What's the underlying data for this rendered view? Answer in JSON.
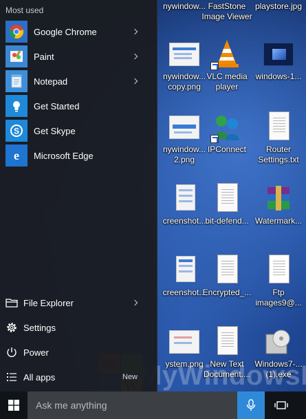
{
  "start_menu": {
    "section_title": "Most used",
    "apps": [
      {
        "label": "Google Chrome",
        "icon": "chrome-icon",
        "has_submenu": true,
        "tile_color": "#2c6fc4"
      },
      {
        "label": "Paint",
        "icon": "paint-icon",
        "has_submenu": true,
        "tile_color": "#3a88d4"
      },
      {
        "label": "Notepad",
        "icon": "notepad-icon",
        "has_submenu": true,
        "tile_color": "#3c8fd8"
      },
      {
        "label": "Get Started",
        "icon": "lightbulb-icon",
        "has_submenu": false,
        "tile_color": "#1e88d9"
      },
      {
        "label": "Get Skype",
        "icon": "skype-icon",
        "has_submenu": false,
        "tile_color": "#1e88d9"
      },
      {
        "label": "Microsoft Edge",
        "icon": "edge-icon",
        "has_submenu": false,
        "tile_color": "#1e74d0"
      }
    ],
    "system": {
      "file_explorer": "File Explorer",
      "settings": "Settings",
      "power": "Power",
      "all_apps": "All apps",
      "new_badge": "New"
    }
  },
  "desktop": {
    "icons": [
      {
        "label": "nywindow...",
        "type": "image"
      },
      {
        "label": "FastStone Image Viewer",
        "type": "app"
      },
      {
        "label": "playstore.jpg",
        "type": "image"
      },
      {
        "label": "nywindow... copy.png",
        "type": "image"
      },
      {
        "label": "VLC media player",
        "type": "vlc"
      },
      {
        "label": "windows-1...",
        "type": "image"
      },
      {
        "label": "nywindow... 2.png",
        "type": "image"
      },
      {
        "label": "IPConnect",
        "type": "ipconnect"
      },
      {
        "label": "Router Settings.txt",
        "type": "text"
      },
      {
        "label": "creenshot...",
        "type": "image"
      },
      {
        "label": "bit-defend...",
        "type": "text"
      },
      {
        "label": "Watermark...",
        "type": "rar"
      },
      {
        "label": "creenshot...",
        "type": "image"
      },
      {
        "label": "Encrypted_...",
        "type": "text"
      },
      {
        "label": "Ftp images9@...",
        "type": "blank"
      },
      {
        "label": "ystem.png",
        "type": "image"
      },
      {
        "label": "New Text Document....",
        "type": "text"
      },
      {
        "label": "Windows7-... (1).exe",
        "type": "installer"
      }
    ]
  },
  "watermark": {
    "text": "MyWindowsHub",
    "letters": [
      "M",
      "W"
    ]
  },
  "taskbar": {
    "search_placeholder": "Ask me anything",
    "accent": "#2e8ad8"
  }
}
